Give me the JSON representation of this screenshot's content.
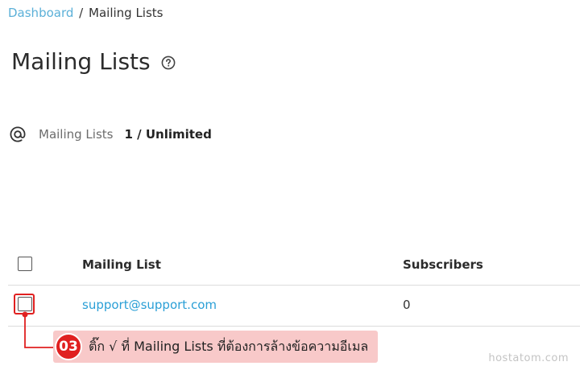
{
  "breadcrumb": {
    "dashboard": "Dashboard",
    "separator": "/",
    "current": "Mailing Lists"
  },
  "page": {
    "title": "Mailing Lists",
    "help_icon": "help-circle-icon"
  },
  "quota": {
    "icon": "at-sign-icon",
    "label": "Mailing Lists",
    "value": "1 / Unlimited"
  },
  "table": {
    "columns": [
      "Mailing List",
      "Subscribers"
    ],
    "rows": [
      {
        "name": "support@support.com",
        "subscribers": "0"
      }
    ]
  },
  "annotation": {
    "step": "03",
    "text": "ติ๊ก √ ที่ Mailing Lists ที่ต้องการล้างข้อความอีเมล",
    "color": "#e02020",
    "background": "#f8c9c9"
  },
  "watermark": "hostatom.com",
  "colors": {
    "link": "#2a9fd6",
    "breadcrumb_link": "#5bb0d8",
    "annotation_red": "#e02020"
  }
}
